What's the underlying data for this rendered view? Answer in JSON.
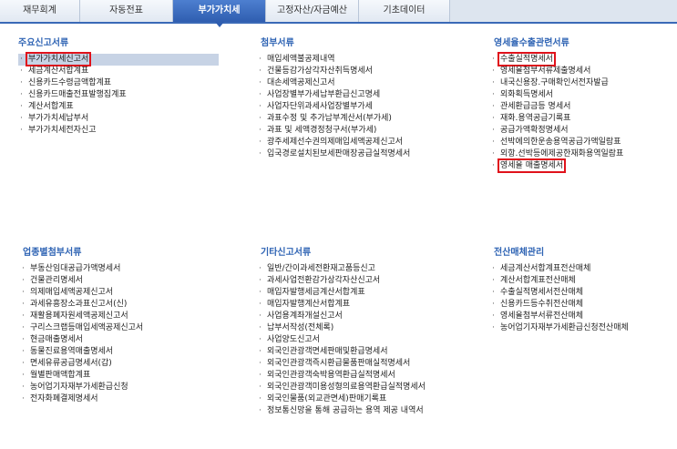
{
  "tabs": [
    {
      "label": "재무회계",
      "active": false
    },
    {
      "label": "자동전표",
      "active": false
    },
    {
      "label": "부가가치세",
      "active": true
    },
    {
      "label": "고정자산/자금예산",
      "active": false
    },
    {
      "label": "기초데이터",
      "active": false
    }
  ],
  "sections": {
    "main_report": {
      "title": "주요신고서류",
      "items": [
        "부가가치세신고서",
        "세금계산서합계표",
        "신용카드수령금액합계표",
        "신용카드매출전표발행집계표",
        "계산서합계표",
        "부가가치세납부서",
        "부가가치세전자신고"
      ]
    },
    "attached": {
      "title": "첨부서류",
      "items": [
        "매입세액불공제내역",
        "건물등감가상각자산취득명세서",
        "대손세액공제신고서",
        "사업장별부가세납부환급신고명세",
        "사업자단위과세사업장별부가세",
        "과표수정 및 추가납부계산서(부가세)",
        "과표 및 세액경정청구서(부가세)",
        "광주세제선수권의제매입세액공제신고서",
        "입국경로설치된보세판매장공급실적명세서"
      ]
    },
    "zero_rate": {
      "title": "영세율수출관련서류",
      "items": [
        "수출실적명세서",
        "영세율첨부서류제출명세서",
        "내국신용장.구매확인서전자발급",
        "외화획득명세서",
        "관세환급금등 명세서",
        "재화.용역공급기록표",
        "공급가액확정명세서",
        "선박에의한운송용역공급가액일람표",
        "외항.선박등에제공한재화용역일람표",
        "영세율 매출명세서"
      ]
    },
    "industry": {
      "title": "업종별첨부서류",
      "items": [
        "부동산임대공급가액명세서",
        "건물관리명세서",
        "의제매입세액공제신고서",
        "과세유흥장소과표신고서(신)",
        "재활용폐자원세액공제신고서",
        "구리스크랩등매입세액공제신고서",
        "현금매출명세서",
        "동물진료용역매출명세서",
        "면세유류공급명세서(갑)",
        "월별판매액합계표",
        "농어업기자재부가세환급신청",
        "전자화폐결제명세서"
      ]
    },
    "other": {
      "title": "기타신고서류",
      "items": [
        "일반/간이과세전환재고품등신고",
        "과세사업전환감가상각자산신고서",
        "매입자발행세금계산서합계표",
        "매입자발행계산서합계표",
        "사업용계좌개설신고서",
        "납부서작성(전체록)",
        "사업양도신고서",
        "외국인관광객면세판매및환급명세서",
        "외국인관광객즉시환급물품판매실적명세서",
        "외국인관광객숙박용역환급실적명세서",
        "외국인관광객미용성형의료용역환급실적명세서",
        "외국인물품(외교관면세)판매기록표",
        "정보통신망을 통해 공급하는 용역 제공 내역서"
      ]
    },
    "electronic": {
      "title": "전산매체관리",
      "items": [
        "세금계산서합계표전산매체",
        "계산서합계표전산매체",
        "수출실적명세서전산매체",
        "신용카드등수취전산매체",
        "영세율첨부서류전산매체",
        "농어업기자재부가세환급신청전산매체"
      ]
    }
  }
}
